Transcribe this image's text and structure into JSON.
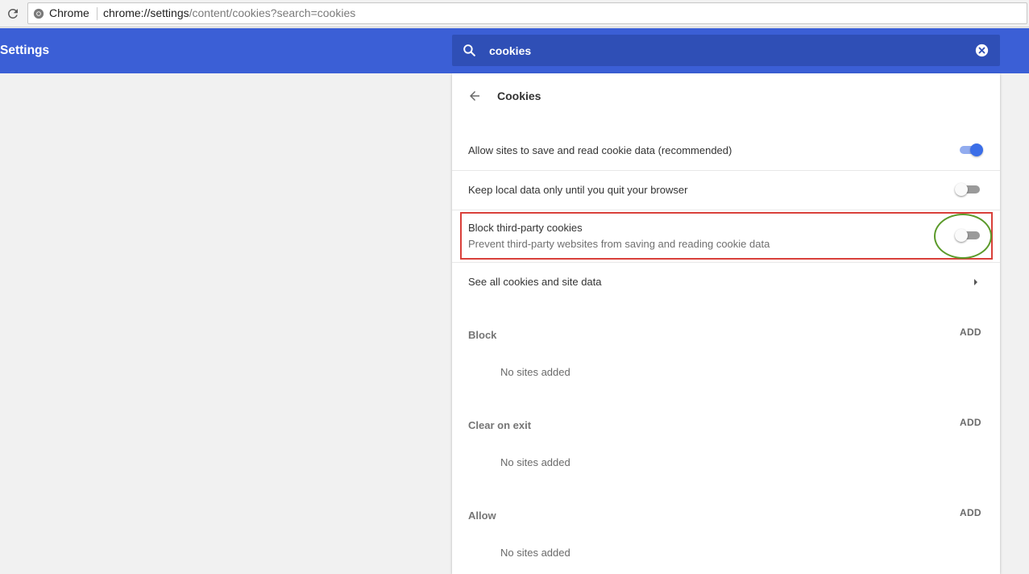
{
  "browser": {
    "chip_label": "Chrome",
    "url_host": "chrome://settings",
    "url_path": "/content/cookies?search=cookies"
  },
  "header": {
    "title": "Settings",
    "search_value": "cookies",
    "color": "#3b5fd6"
  },
  "card": {
    "title": "Cookies",
    "rows": [
      {
        "label": "Allow sites to save and read cookie data (recommended)",
        "enabled": true
      },
      {
        "label": "Keep local data only until you quit your browser",
        "enabled": false
      },
      {
        "label": "Block third-party cookies",
        "sublabel": "Prevent third-party websites from saving and reading cookie data",
        "enabled": false
      }
    ],
    "see_all_label": "See all cookies and site data",
    "sections": [
      {
        "title": "Block",
        "add_label": "ADD",
        "empty_text": "No sites added"
      },
      {
        "title": "Clear on exit",
        "add_label": "ADD",
        "empty_text": "No sites added"
      },
      {
        "title": "Allow",
        "add_label": "ADD",
        "empty_text": "No sites added"
      }
    ]
  },
  "icons": [
    "reload-icon",
    "chrome-logo-icon",
    "search-icon",
    "clear-search-icon",
    "back-icon",
    "chevron-right-icon"
  ],
  "annotation_colors": {
    "box": "#d9403a",
    "ellipse": "#5b9a2a"
  }
}
